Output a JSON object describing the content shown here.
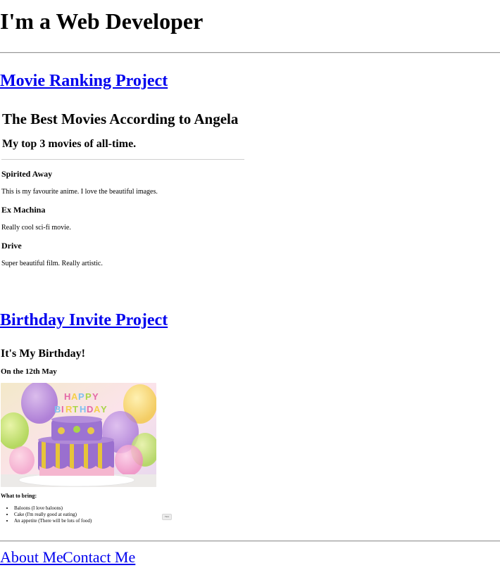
{
  "header": {
    "title": "I'm a Web Developer"
  },
  "projects": {
    "movie_link": "Movie Ranking Project",
    "birthday_link": "Birthday Invite Project"
  },
  "movie_page": {
    "heading": "The Best Movies According to Angela",
    "subheading": "My top 3 movies of all-time.",
    "movies": [
      {
        "title": "Spirited Away",
        "description": "This is my favourite anime. I love the beautiful images."
      },
      {
        "title": "Ex Machina",
        "description": "Really cool sci-fi movie."
      },
      {
        "title": "Drive",
        "description": "Super beautiful film. Really artistic."
      }
    ]
  },
  "birthday_page": {
    "heading": "It's My Birthday!",
    "date": "On the 12th May",
    "cake_text": "HAPPY BIRTHDAY",
    "bring_heading": "What to bring:",
    "items": [
      "Baloons (I love baloons)",
      "Cake (I'm really good at eating)",
      "An appetite (There will be lots of food)"
    ],
    "button_label": "View"
  },
  "footer": {
    "about_link": "About Me",
    "contact_link": "Contact Me"
  },
  "colors": {
    "link": "#0000ee",
    "rule": "#999999"
  }
}
